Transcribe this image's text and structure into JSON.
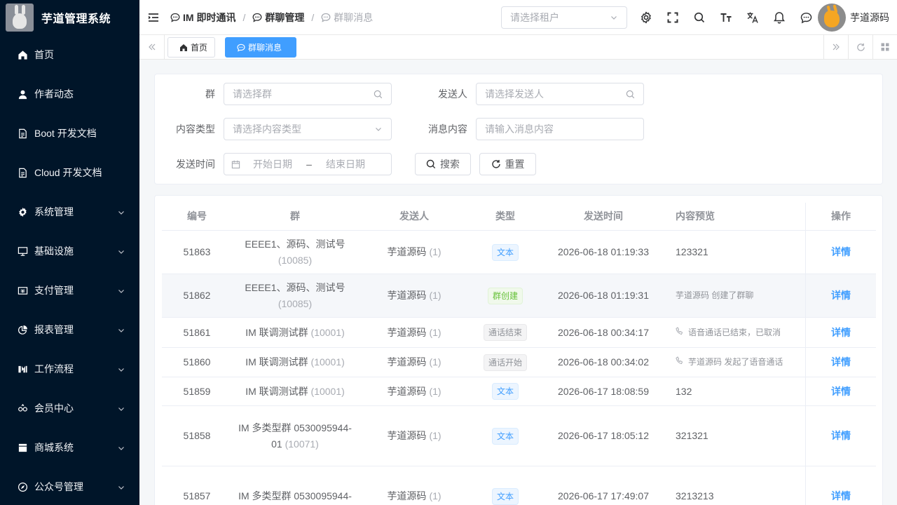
{
  "app": {
    "title": "芋道管理系统"
  },
  "sidebar": {
    "items": [
      {
        "label": "首页",
        "icon": "home-icon"
      },
      {
        "label": "作者动态",
        "icon": "user-icon"
      },
      {
        "label": "Boot 开发文档",
        "icon": "document-icon"
      },
      {
        "label": "Cloud 开发文档",
        "icon": "document-icon"
      },
      {
        "label": "系统管理",
        "icon": "gear-icon",
        "expandable": true
      },
      {
        "label": "基础设施",
        "icon": "monitor-icon",
        "expandable": true
      },
      {
        "label": "支付管理",
        "icon": "wallet-icon",
        "expandable": true
      },
      {
        "label": "报表管理",
        "icon": "pie-chart-icon",
        "expandable": true
      },
      {
        "label": "工作流程",
        "icon": "flow-icon",
        "expandable": true
      },
      {
        "label": "会员中心",
        "icon": "members-icon",
        "expandable": true
      },
      {
        "label": "商城系统",
        "icon": "shop-icon",
        "expandable": true
      },
      {
        "label": "公众号管理",
        "icon": "compass-icon",
        "expandable": true
      }
    ]
  },
  "header": {
    "breadcrumb": [
      "IM 即时通讯",
      "群聊管理",
      "群聊消息"
    ],
    "tenant_placeholder": "请选择租户",
    "user_name": "芋道源码"
  },
  "tags": {
    "home": "首页",
    "active": "群聊消息"
  },
  "search": {
    "group_label": "群",
    "group_placeholder": "请选择群",
    "sender_label": "发送人",
    "sender_placeholder": "请选择发送人",
    "type_label": "内容类型",
    "type_placeholder": "请选择内容类型",
    "content_label": "消息内容",
    "content_placeholder": "请输入消息内容",
    "time_label": "发送时间",
    "start_placeholder": "开始日期",
    "range_sep": "–",
    "end_placeholder": "结束日期",
    "search_button": "搜索",
    "reset_button": "重置"
  },
  "table": {
    "columns": [
      "编号",
      "群",
      "发送人",
      "类型",
      "发送时间",
      "内容预览",
      "操作"
    ],
    "rows": [
      {
        "id": "51863",
        "group": "EEEE1、源码、测试号",
        "group_id": "(10085)",
        "sender": "芋道源码",
        "sender_id": "(1)",
        "type": "文本",
        "type_style": "blue",
        "time": "2026-06-18 01:19:33",
        "preview": "123321",
        "preview_style": "plain",
        "action": "详情"
      },
      {
        "id": "51862",
        "group": "EEEE1、源码、测试号",
        "group_id": "(10085)",
        "sender": "芋道源码",
        "sender_id": "(1)",
        "type": "群创建",
        "type_style": "green",
        "time": "2026-06-18 01:19:31",
        "preview": "芋道源码 创建了群聊",
        "preview_style": "system",
        "action": "详情"
      },
      {
        "id": "51861",
        "group": "IM 联调测试群",
        "group_id": "(10001)",
        "sender": "芋道源码",
        "sender_id": "(1)",
        "type": "通话结束",
        "type_style": "gray",
        "time": "2026-06-18 00:34:17",
        "preview": "语音通话已结束，已取消",
        "preview_style": "call",
        "action": "详情"
      },
      {
        "id": "51860",
        "group": "IM 联调测试群",
        "group_id": "(10001)",
        "sender": "芋道源码",
        "sender_id": "(1)",
        "type": "通话开始",
        "type_style": "gray",
        "time": "2026-06-18 00:34:02",
        "preview": "芋道源码 发起了语音通话",
        "preview_style": "call",
        "action": "详情"
      },
      {
        "id": "51859",
        "group": "IM 联调测试群",
        "group_id": "(10001)",
        "sender": "芋道源码",
        "sender_id": "(1)",
        "type": "文本",
        "type_style": "blue",
        "time": "2026-06-17 18:08:59",
        "preview": "132",
        "preview_style": "plain",
        "action": "详情"
      },
      {
        "id": "51858",
        "group": "IM 多类型群 0530095944-01",
        "group_id": "(10071)",
        "sender": "芋道源码",
        "sender_id": "(1)",
        "type": "文本",
        "type_style": "blue",
        "time": "2026-06-17 18:05:12",
        "preview": "321321",
        "preview_style": "plain",
        "action": "详情"
      },
      {
        "id": "51857",
        "group": "IM 多类型群 0530095944-",
        "group_id": "",
        "sender": "芋道源码",
        "sender_id": "(1)",
        "type": "文本",
        "type_style": "blue",
        "time": "2026-06-17 17:49:07",
        "preview": "3213213",
        "preview_style": "plain",
        "action": "详情"
      }
    ]
  }
}
